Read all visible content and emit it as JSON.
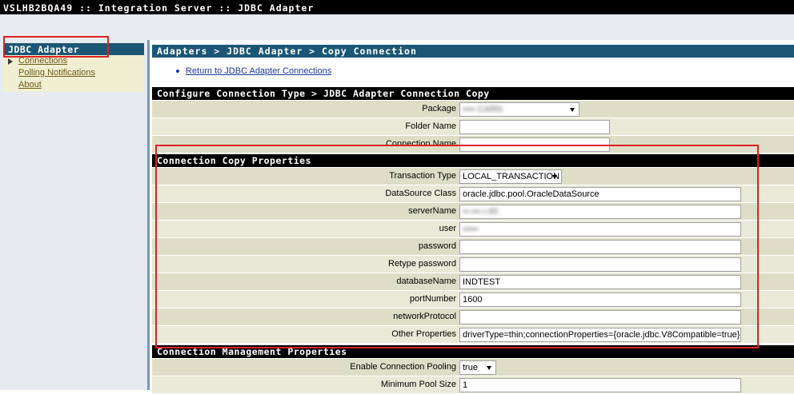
{
  "window": {
    "title": "VSLHB2BQA49 :: Integration Server :: JDBC Adapter"
  },
  "sidebar": {
    "heading": "JDBC Adapter",
    "items": [
      {
        "label": "Connections",
        "active": true
      },
      {
        "label": "Polling Notifications"
      },
      {
        "label": "About"
      }
    ]
  },
  "main": {
    "breadcrumb": "Adapters > JDBC Adapter > Copy Connection",
    "return_link": "Return to JDBC Adapter Connections",
    "configure_section": {
      "title": "Configure Connection Type > JDBC Adapter Connection Copy",
      "package_label": "Package",
      "package_value": "•••• CARN",
      "folder_label": "Folder Name",
      "folder_value": "",
      "connection_name_label": "Connection Name",
      "connection_name_value": ""
    },
    "copy_section": {
      "title": "Connection Copy Properties",
      "transaction_type_label": "Transaction Type",
      "transaction_type_value": "LOCAL_TRANSACTION",
      "datasource_label": "DataSource Class",
      "datasource_value": "oracle.jdbc.pool.OracleDataSource",
      "servername_label": "serverName",
      "servername_value": "••.•••.•.85",
      "user_label": "user",
      "user_value": "•••••",
      "password_label": "password",
      "password_value": "",
      "retype_label": "Retype password",
      "retype_value": "",
      "database_label": "databaseName",
      "database_value": "INDTEST",
      "port_label": "portNumber",
      "port_value": "1600",
      "network_label": "networkProtocol",
      "network_value": "",
      "other_label": "Other Properties",
      "other_value": "driverType=thin;connectionProperties={oracle.jdbc.V8Compatible=true}"
    },
    "management_section": {
      "title": "Connection Management Properties",
      "pooling_label": "Enable Connection Pooling",
      "pooling_value": "true",
      "min_pool_label": "Minimum Pool Size",
      "min_pool_value": "1"
    }
  },
  "colors": {
    "header_blue": "#1b5774",
    "section_black": "#000000",
    "row_tan": "#dedec8",
    "highlight_red": "#e02020"
  }
}
